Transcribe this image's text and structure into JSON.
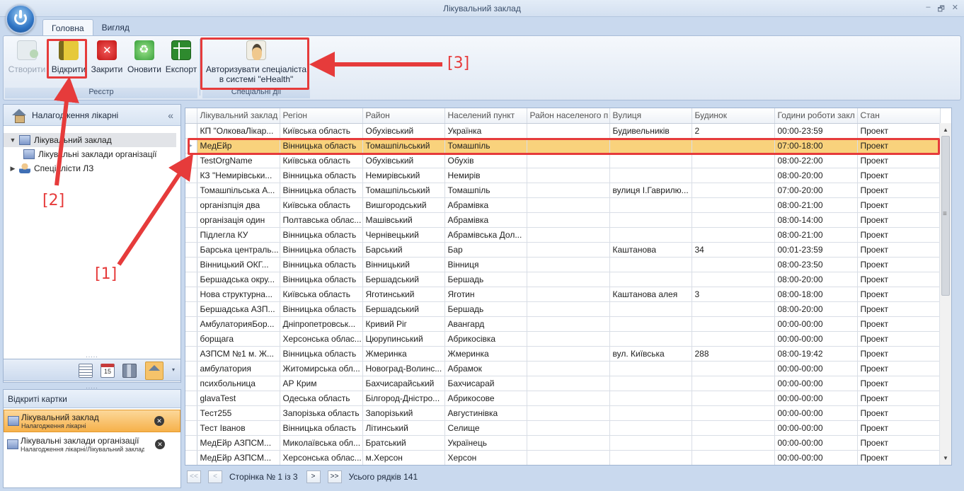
{
  "window": {
    "title": "Лікувальний заклад",
    "controls": [
      "‒",
      "🗗",
      "✕"
    ]
  },
  "ribbon": {
    "tabs": [
      {
        "label": "Головна",
        "active": true
      },
      {
        "label": "Вигляд",
        "active": false
      }
    ],
    "groups": {
      "registry": {
        "label": "Реєстр",
        "buttons": {
          "create": "Створити",
          "open": "Відкрити",
          "close": "Закрити",
          "refresh": "Оновити",
          "export": "Експорт"
        }
      },
      "special": {
        "label": "Спеціальні дії",
        "authorize_line1": "Авторизувати спеціаліста",
        "authorize_line2": "в системі \"eHealth\""
      }
    }
  },
  "nav": {
    "header": "Налагодження лікарні",
    "collapse_glyph": "«",
    "tree": [
      {
        "label": "Лікувальний заклад",
        "expanded": true,
        "selected": true
      },
      {
        "label": "Лікувальні заклади організації",
        "child": true
      },
      {
        "label": "Спеціалісти ЛЗ",
        "expanded": false
      }
    ],
    "calendar_day": "15",
    "splitter_grip": ".....",
    "more_arrow": "▾"
  },
  "open_cards": {
    "header": "Відкриті картки",
    "close_glyph": "✕",
    "cards": [
      {
        "title": "Лікувальний заклад",
        "path": "Налагодження лікарні",
        "active": true
      },
      {
        "title": "Лікувальні заклади організації",
        "path": "Налагодження лікарні/Лікувальний заклад",
        "active": false
      }
    ]
  },
  "grid": {
    "columns": [
      "Лікувальний заклад",
      "Регіон",
      "Район",
      "Населений пункт",
      "Район населеного п",
      "Вулиця",
      "Будинок",
      "Години роботи закл",
      "Стан"
    ],
    "selected_index": 1,
    "row_indicator": "▸",
    "rows": [
      [
        "КП \"ОлковаЛікар...",
        "Київська область",
        "Обухівський",
        "Українка",
        "",
        "Будивельників",
        "2",
        "00:00-23:59",
        "Проект"
      ],
      [
        "МедЕйр",
        "Вінницька область",
        "Томашпільський",
        "Томашпіль",
        "",
        "",
        "",
        "07:00-18:00",
        "Проект"
      ],
      [
        "TestOrgName",
        "Київська область",
        "Обухівський",
        "Обухів",
        "",
        "",
        "",
        "08:00-22:00",
        "Проект"
      ],
      [
        "КЗ \"Немирівськи...",
        "Вінницька область",
        "Немирівський",
        "Немирів",
        "",
        "",
        "",
        "08:00-20:00",
        "Проект"
      ],
      [
        "Томашпільська А...",
        "Вінницька область",
        "Томашпільський",
        "Томашпіль",
        "",
        "вулиця І.Гаврилю...",
        "",
        "07:00-20:00",
        "Проект"
      ],
      [
        "організпція два",
        "Київська область",
        "Вишгородський",
        "Абрамівка",
        "",
        "",
        "",
        "08:00-21:00",
        "Проект"
      ],
      [
        "організація один",
        "Полтавська облас...",
        "Машівський",
        "Абрамівка",
        "",
        "",
        "",
        "08:00-14:00",
        "Проект"
      ],
      [
        "Підлегла КУ",
        "Вінницька область",
        "Чернівецький",
        "Абрамівська Дол...",
        "",
        "",
        "",
        "08:00-21:00",
        "Проект"
      ],
      [
        "Барська централь...",
        "Вінницька область",
        "Барський",
        "Бар",
        "",
        "Каштанова",
        "34",
        "00:01-23:59",
        "Проект"
      ],
      [
        "Вінницький ОКГ...",
        "Вінницька область",
        "Вінницький",
        "Вінниця",
        "",
        "",
        "",
        "08:00-23:50",
        "Проект"
      ],
      [
        "Бершадська окру...",
        "Вінницька область",
        "Бершадський",
        "Бершадь",
        "",
        "",
        "",
        "08:00-20:00",
        "Проект"
      ],
      [
        "Нова структурна...",
        "Київська область",
        "Яготинський",
        "Яготин",
        "",
        "Каштанова алея",
        "3",
        "08:00-18:00",
        "Проект"
      ],
      [
        "Бершадська АЗП...",
        "Вінницька область",
        "Бершадський",
        "Бершадь",
        "",
        "",
        "",
        "08:00-20:00",
        "Проект"
      ],
      [
        "АмбулаторияБор...",
        "Дніпропетровськ...",
        "Кривий Ріг",
        "Авангард",
        "",
        "",
        "",
        "00:00-00:00",
        "Проект"
      ],
      [
        "борщага",
        "Херсонська облас...",
        "Цюрупинський",
        "Абрикосівка",
        "",
        "",
        "",
        "00:00-00:00",
        "Проект"
      ],
      [
        "АЗПСМ №1 м. Ж...",
        "Вінницька область",
        "Жмеринка",
        "Жмеринка",
        "",
        "вул. Київська",
        "288",
        "08:00-19:42",
        "Проект"
      ],
      [
        "амбулатория",
        "Житомирська обл...",
        "Новоград-Волинс...",
        "Абрамок",
        "",
        "",
        "",
        "00:00-00:00",
        "Проект"
      ],
      [
        "психбольница",
        "АР Крим",
        "Бахчисарайський",
        "Бахчисарай",
        "",
        "",
        "",
        "00:00-00:00",
        "Проект"
      ],
      [
        "glavaTest",
        "Одеська область",
        "Білгород-Дністро...",
        "Абрикосове",
        "",
        "",
        "",
        "00:00-00:00",
        "Проект"
      ],
      [
        "Тест255",
        "Запорізька область",
        "Запорізький",
        "Августинівка",
        "",
        "",
        "",
        "00:00-00:00",
        "Проект"
      ],
      [
        "Тест Іванов",
        "Вінницька область",
        "Літинський",
        "Селище",
        "",
        "",
        "",
        "00:00-00:00",
        "Проект"
      ],
      [
        "МедЕйр АЗПСМ...",
        "Миколаївська обл...",
        "Братський",
        "Українець",
        "",
        "",
        "",
        "00:00-00:00",
        "Проект"
      ],
      [
        "МедЕйр АЗПСМ...",
        "Херсонська облас...",
        "м.Херсон",
        "Херсон",
        "",
        "",
        "",
        "00:00-00:00",
        "Проект"
      ]
    ],
    "scroll_up": "▲",
    "scroll_down": "▼"
  },
  "pager": {
    "first": "<<",
    "prev": "<",
    "next": ">",
    "last": ">>",
    "page_text": "Сторінка № 1 із 3",
    "total_text": "Усього рядків 141"
  },
  "annotations": {
    "label1": "[1]",
    "label2": "[2]",
    "label3": "[3]",
    "color": "#e63b3b"
  }
}
